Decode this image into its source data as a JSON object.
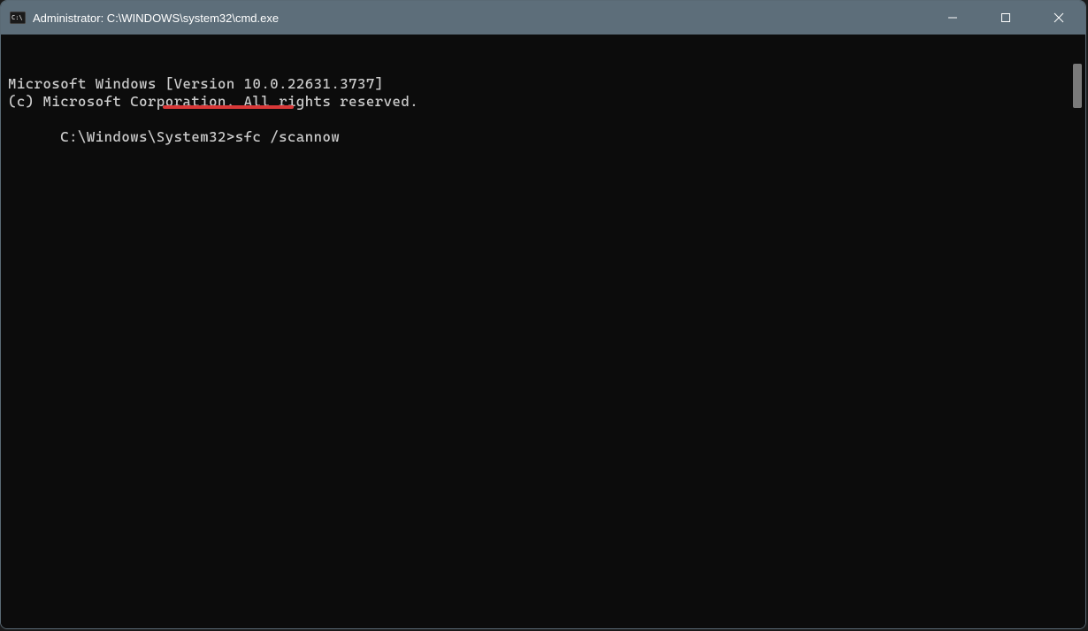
{
  "titlebar": {
    "title": "Administrator: C:\\WINDOWS\\system32\\cmd.exe"
  },
  "terminal": {
    "line1": "Microsoft Windows [Version 10.0.22631.3737]",
    "line2": "(c) Microsoft Corporation. All rights reserved.",
    "prompt": "C:\\Windows\\System32>",
    "command": "sfc /scannow"
  },
  "annotation": {
    "underline_color": "#d93838"
  }
}
